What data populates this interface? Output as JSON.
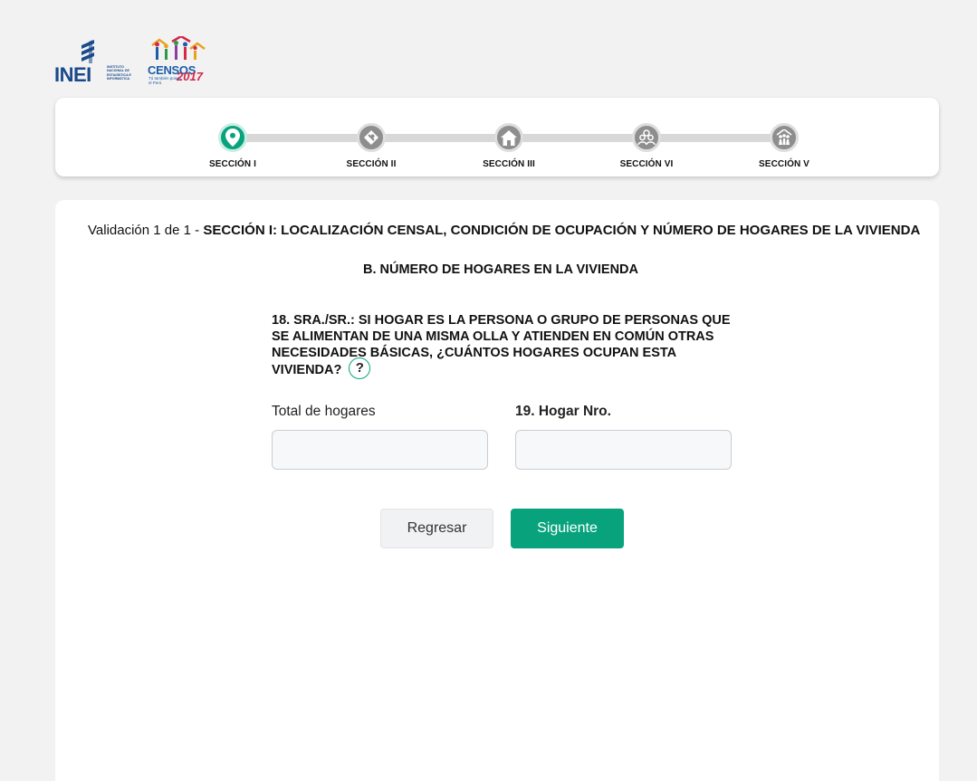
{
  "logos": {
    "inei": {
      "name": "INEI",
      "subtitle": "INSTITUTO NACIONAL DE ESTADÍSTICA E INFORMÁTICA"
    },
    "censos": {
      "name": "CENSOS",
      "year": "2017",
      "tagline": "Tú también pones el Perú"
    }
  },
  "stepper": {
    "steps": [
      {
        "label": "SECCIÓN I",
        "icon": "location-pin-icon",
        "active": true
      },
      {
        "label": "SECCIÓN II",
        "icon": "map-icon",
        "active": false
      },
      {
        "label": "SECCIÓN III",
        "icon": "house-icon",
        "active": false
      },
      {
        "label": "SECCIÓN VI",
        "icon": "people-icon",
        "active": false
      },
      {
        "label": "SECCIÓN V",
        "icon": "household-icon",
        "active": false
      }
    ],
    "colors": {
      "active": "#08a37d",
      "inactive": "#8e8e8e"
    }
  },
  "header": {
    "validation_prefix": "Validación 1 de 1 - ",
    "section_title": "SECCIÓN I: LOCALIZACIÓN CENSAL, CONDICIÓN DE OCUPACIÓN Y NÚMERO DE HOGARES DE LA VIVIENDA",
    "subtitle": "B. NÚMERO DE HOGARES EN LA VIVIENDA"
  },
  "question": {
    "text": "18. SRA./SR.: SI HOGAR ES LA PERSONA O GRUPO DE PERSONAS QUE SE ALIMENTAN DE UNA MISMA OLLA Y ATIENDEN EN COMÚN OTRAS NECESIDADES BÁSICAS, ¿CUÁNTOS HOGARES OCUPAN ESTA VIVIENDA?",
    "help_symbol": "?"
  },
  "fields": {
    "total_hogares": {
      "label": "Total de hogares",
      "value": "",
      "placeholder": ""
    },
    "hogar_nro": {
      "label": "19. Hogar Nro.",
      "value": "",
      "placeholder": ""
    }
  },
  "buttons": {
    "back": "Regresar",
    "next": "Siguiente"
  }
}
